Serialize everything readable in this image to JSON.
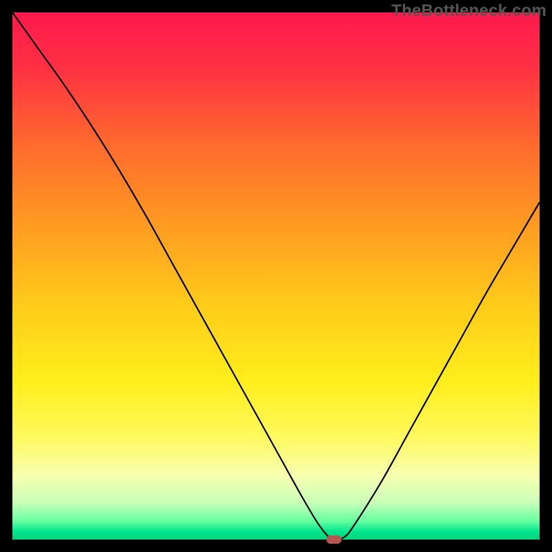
{
  "watermark": "TheBottleneck.com",
  "colors": {
    "background": "#000000",
    "curve": "#000000",
    "marker": "#b5564f",
    "watermark": "#555555",
    "gradient_stops": [
      {
        "offset": 0.0,
        "color": "#ff1a4d"
      },
      {
        "offset": 0.1,
        "color": "#ff2f44"
      },
      {
        "offset": 0.25,
        "color": "#ff6a2e"
      },
      {
        "offset": 0.4,
        "color": "#ff9a22"
      },
      {
        "offset": 0.55,
        "color": "#ffca1a"
      },
      {
        "offset": 0.7,
        "color": "#ffee1c"
      },
      {
        "offset": 0.8,
        "color": "#fff95a"
      },
      {
        "offset": 0.88,
        "color": "#f7ffb0"
      },
      {
        "offset": 0.93,
        "color": "#c8ffb8"
      },
      {
        "offset": 0.965,
        "color": "#66ffa0"
      },
      {
        "offset": 0.985,
        "color": "#00e58c"
      },
      {
        "offset": 1.0,
        "color": "#00d47e"
      }
    ]
  },
  "chart_data": {
    "type": "line",
    "title": "",
    "xlabel": "",
    "ylabel": "",
    "xlim": [
      0,
      100
    ],
    "ylim": [
      0,
      100
    ],
    "grid": false,
    "note": "Bottleneck-style V-curve. Minimum (optimal match) around x≈61 where y≈0. Values are read from the figure in normalized 0–100 space.",
    "series": [
      {
        "name": "bottleneck-curve",
        "x": [
          0,
          5,
          10,
          15,
          20,
          25,
          30,
          35,
          40,
          45,
          50,
          55,
          58,
          60,
          61,
          63,
          65,
          70,
          75,
          80,
          85,
          90,
          95,
          100
        ],
        "y": [
          100,
          93,
          86,
          78.5,
          70.5,
          62,
          53,
          44,
          35,
          26,
          17,
          8,
          3,
          0.5,
          0,
          0.5,
          3,
          11,
          20,
          29,
          38,
          47,
          55.5,
          64
        ]
      }
    ],
    "marker": {
      "x": 61,
      "y": 0,
      "label": "optimal-point"
    }
  }
}
